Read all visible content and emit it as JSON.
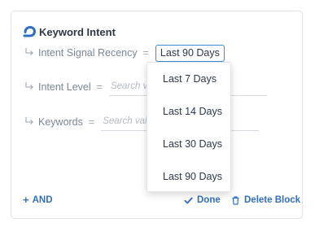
{
  "block": {
    "title": "Keyword Intent",
    "rows": [
      {
        "label": "Intent Signal Recency",
        "operator": "=",
        "value": "Last 90 Days"
      },
      {
        "label": "Intent Level",
        "operator": "=",
        "placeholder": "Search va"
      },
      {
        "label": "Keywords",
        "operator": "=",
        "placeholder": "Search valu"
      }
    ]
  },
  "dropdown": {
    "options": [
      "Last 7 Days",
      "Last 14 Days",
      "Last 30 Days",
      "Last 90 Days"
    ]
  },
  "footer": {
    "add_label": "AND",
    "done_label": "Done",
    "delete_label": "Delete Block"
  },
  "icons": {
    "brand": "brand-logo-icon",
    "row": "return-arrow-icon",
    "add": "plus-icon",
    "done": "checkmark-icon",
    "delete": "trash-icon"
  },
  "colors": {
    "accent": "#2f6fc1",
    "select_border": "#3a8fd6",
    "text_primary": "#2d3748",
    "text_muted": "#7a8594"
  }
}
